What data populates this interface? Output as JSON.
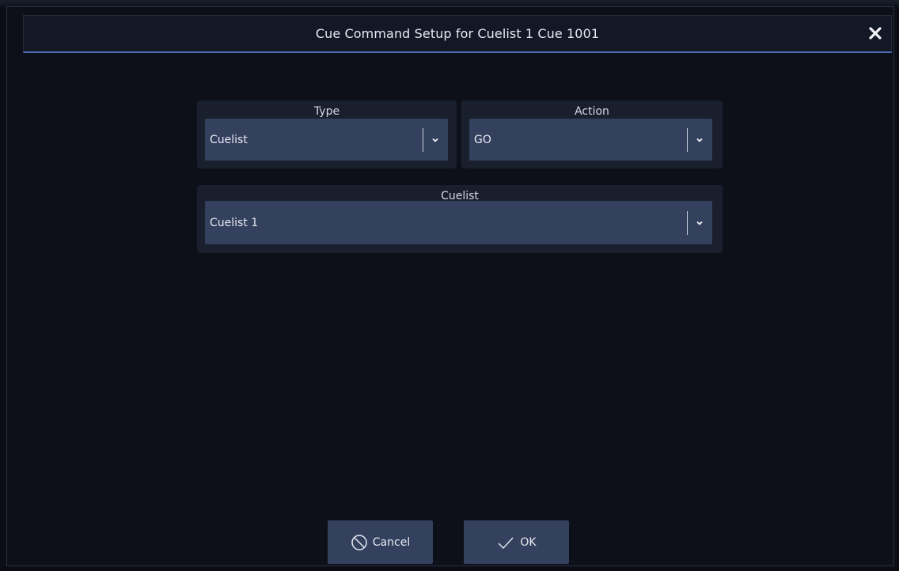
{
  "dialog": {
    "title": "Cue Command Setup for Cuelist 1 Cue 1001"
  },
  "fields": {
    "type": {
      "label": "Type",
      "value": "Cuelist"
    },
    "action": {
      "label": "Action",
      "value": "GO"
    },
    "cuelist": {
      "label": "Cuelist",
      "value": "Cuelist 1"
    }
  },
  "buttons": {
    "cancel_label": "Cancel",
    "ok_label": "OK"
  },
  "icons": {
    "close": "close-icon",
    "chevron": "chevron-down-icon",
    "cancel": "cancel-icon",
    "ok": "checkmark-icon"
  },
  "colors": {
    "accent": "#4f6db0",
    "control_fill": "#33405e",
    "panel_fill": "#1a1f2e",
    "background": "#0d1019"
  }
}
